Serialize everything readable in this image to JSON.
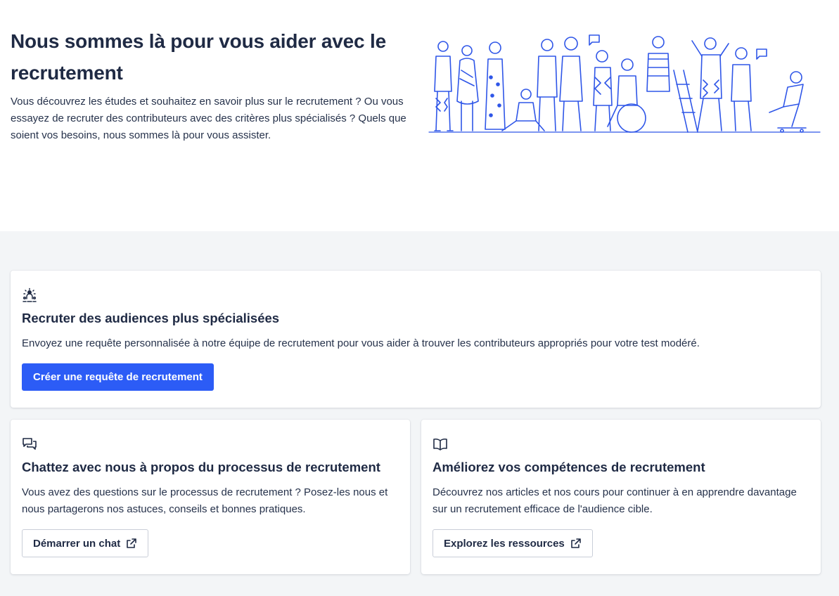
{
  "hero": {
    "title": "Nous sommes là pour vous aider avec le recrutement",
    "description": "Vous découvrez les études et souhaitez en savoir plus sur le recrutement ? Ou vous essayez de recruter des contributeurs avec des critères plus spécialisés ? Quels que soient vos besoins, nous sommes là pour vous assister.",
    "illustration_icon": "people-crowd-illustration"
  },
  "cards": {
    "specialized": {
      "icon": "audience-target-icon",
      "title": "Recruter des audiences plus spécialisées",
      "description": "Envoyez une requête personnalisée à notre équipe de recrutement pour vous aider à trouver les contributeurs appropriés pour votre test modéré.",
      "button_label": "Créer une requête de recrutement"
    },
    "chat": {
      "icon": "chat-bubbles-icon",
      "title": "Chattez avec nous à propos du processus de recrutement",
      "description": "Vous avez des questions sur le processus de recrutement ? Posez-les nous et nous partagerons nos astuces, conseils et bonnes pratiques.",
      "button_label": "Démarrer un chat",
      "button_icon": "external-link-icon"
    },
    "skills": {
      "icon": "open-book-icon",
      "title": "Améliorez vos compétences de recrutement",
      "description": "Découvrez nos articles et nos cours pour continuer à en apprendre davantage sur un recrutement efficace de l'audience cible.",
      "button_label": "Explorez les ressources",
      "button_icon": "external-link-icon"
    }
  },
  "colors": {
    "primary": "#2c5cf6",
    "text": "#1f2a44",
    "section_bg": "#f3f5f7",
    "illustration": "#2f56e8"
  }
}
